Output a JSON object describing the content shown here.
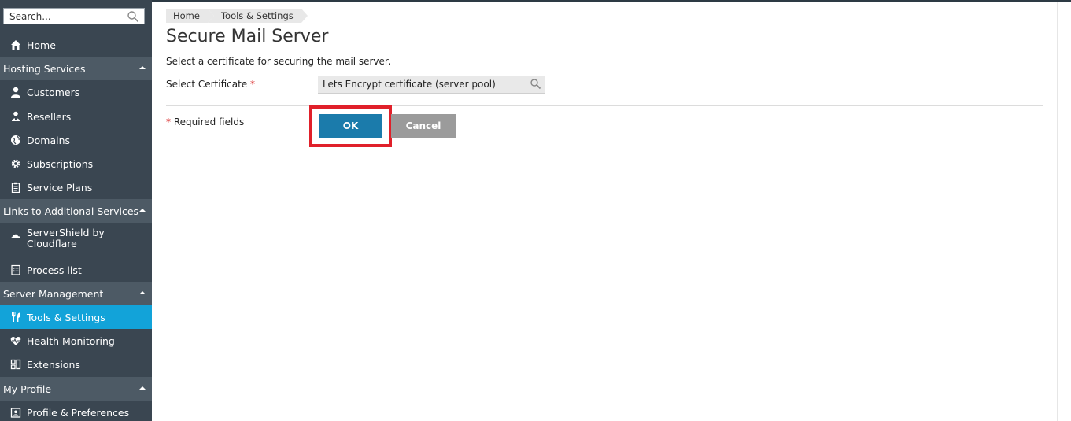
{
  "sidebar": {
    "search_placeholder": "Search...",
    "home": "Home",
    "sections": {
      "hosting": "Hosting Services",
      "links": "Links to Additional Services",
      "server": "Server Management",
      "profile": "My Profile"
    },
    "items": {
      "customers": "Customers",
      "resellers": "Resellers",
      "domains": "Domains",
      "subscriptions": "Subscriptions",
      "service_plans": "Service Plans",
      "servershield_line1": "ServerShield by",
      "servershield_line2": "Cloudflare",
      "process_list": "Process list",
      "tools_settings": "Tools & Settings",
      "health_monitoring": "Health Monitoring",
      "extensions": "Extensions",
      "profile_preferences": "Profile & Preferences"
    },
    "active_item": "Tools & Settings",
    "colors": {
      "bg": "#3a4651",
      "section_bg": "#4d5a65",
      "active": "#12a3d9"
    }
  },
  "breadcrumb": [
    "Home",
    "Tools & Settings"
  ],
  "page": {
    "title": "Secure Mail Server",
    "hint": "Select a certificate for securing the mail server.",
    "certificate_label": "Select Certificate",
    "required_marker": "*",
    "certificate_value": "Lets Encrypt certificate (server pool)",
    "required_note": "Required fields"
  },
  "buttons": {
    "ok": "OK",
    "cancel": "Cancel"
  },
  "colors": {
    "ok_button": "#1b7bab",
    "cancel_button": "#9b9b9b",
    "highlight_box": "#e0202a"
  }
}
